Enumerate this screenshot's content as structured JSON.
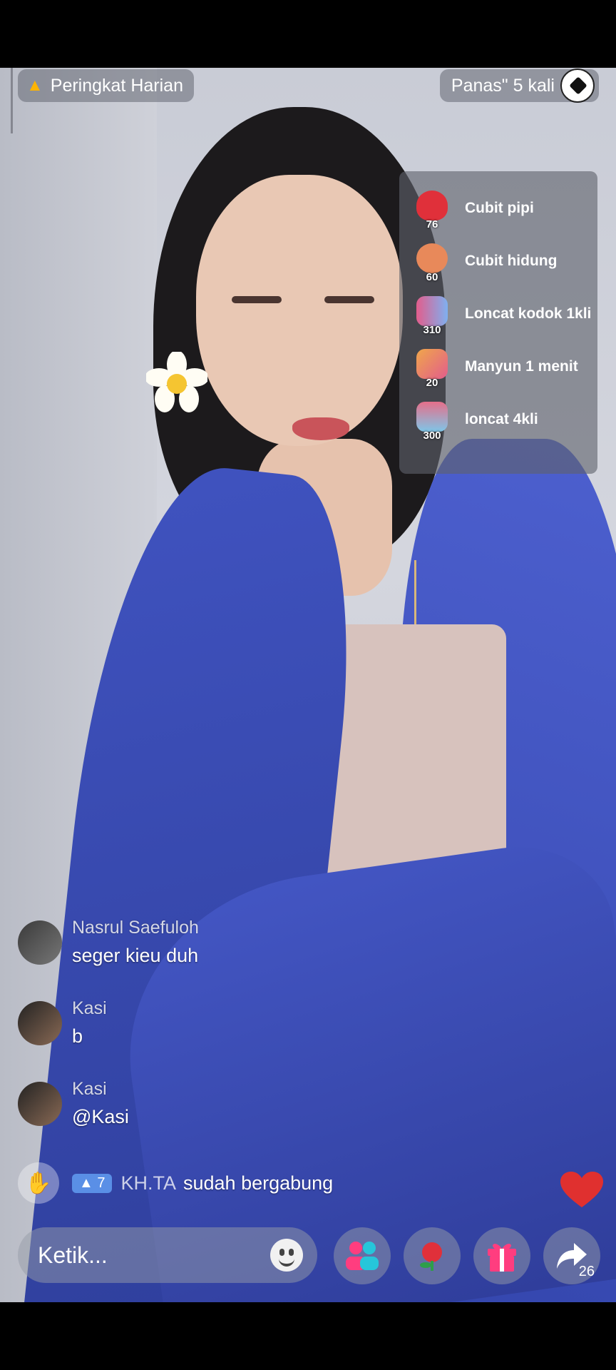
{
  "top_bar": {
    "ranking_label": "Peringkat Harian",
    "hot_label": "Panas\" 5 kali"
  },
  "gift_menu": [
    {
      "price": "76",
      "label": "Cubit pipi",
      "color": "#e0303a"
    },
    {
      "price": "60",
      "label": "Cubit hidung",
      "color": "#e8895a"
    },
    {
      "price": "310",
      "label": "Loncat kodok 1kli",
      "color": "#e25d8c"
    },
    {
      "price": "20",
      "label": "Manyun 1 menit",
      "color": "#f0a64a"
    },
    {
      "price": "300",
      "label": "loncat 4kli",
      "color": "#e56f8a"
    }
  ],
  "chat": [
    {
      "name": "Nasrul Saefuloh",
      "message": "seger kieu duh"
    },
    {
      "name": "Kasi",
      "message": "b"
    },
    {
      "name": "Kasi",
      "message": "@Kasi"
    }
  ],
  "join_notice": {
    "level": "7",
    "user": "KH.TA",
    "text": "sudah bergabung"
  },
  "bottom_bar": {
    "input_placeholder": "Ketik...",
    "share_count": "26"
  },
  "colors": {
    "accent_pink": "#ff3d7f",
    "heart": "#e0302f",
    "level_badge": "#5a8fe6"
  }
}
